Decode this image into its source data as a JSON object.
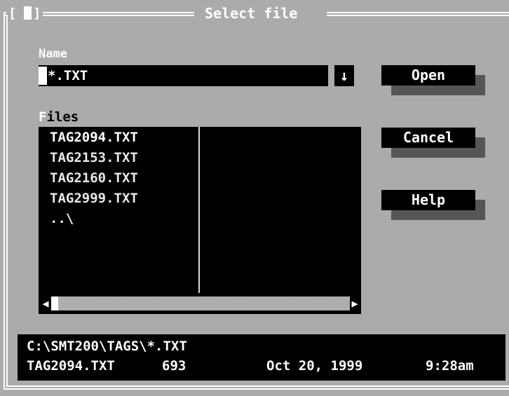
{
  "dialog": {
    "title": "Select file",
    "close_box_left": "[",
    "close_box_right": "]"
  },
  "name_field": {
    "label": "Name",
    "value": "*.TXT",
    "dropdown_arrow": "↓"
  },
  "files": {
    "label_hotkey": "F",
    "label_rest": "iles",
    "items": [
      "TAG2094.TXT",
      "TAG2153.TXT",
      "TAG2160.TXT",
      "TAG2999.TXT",
      "..\\"
    ],
    "selected_index": 0
  },
  "buttons": {
    "open": "Open",
    "cancel": "Cancel",
    "help": "Help"
  },
  "scrollbar": {
    "left_arrow": "◀",
    "right_arrow": "▶"
  },
  "status": {
    "path": "C:\\SMT200\\TAGS\\*.TXT",
    "file_name": "TAG2094.TXT",
    "file_size": "693",
    "file_date": "Oct 20, 1999",
    "file_time": "9:28am"
  },
  "colors": {
    "dialog_bg": "#ababab",
    "field_bg": "#000000",
    "shadow": "#565656",
    "text": "#ffffff"
  }
}
